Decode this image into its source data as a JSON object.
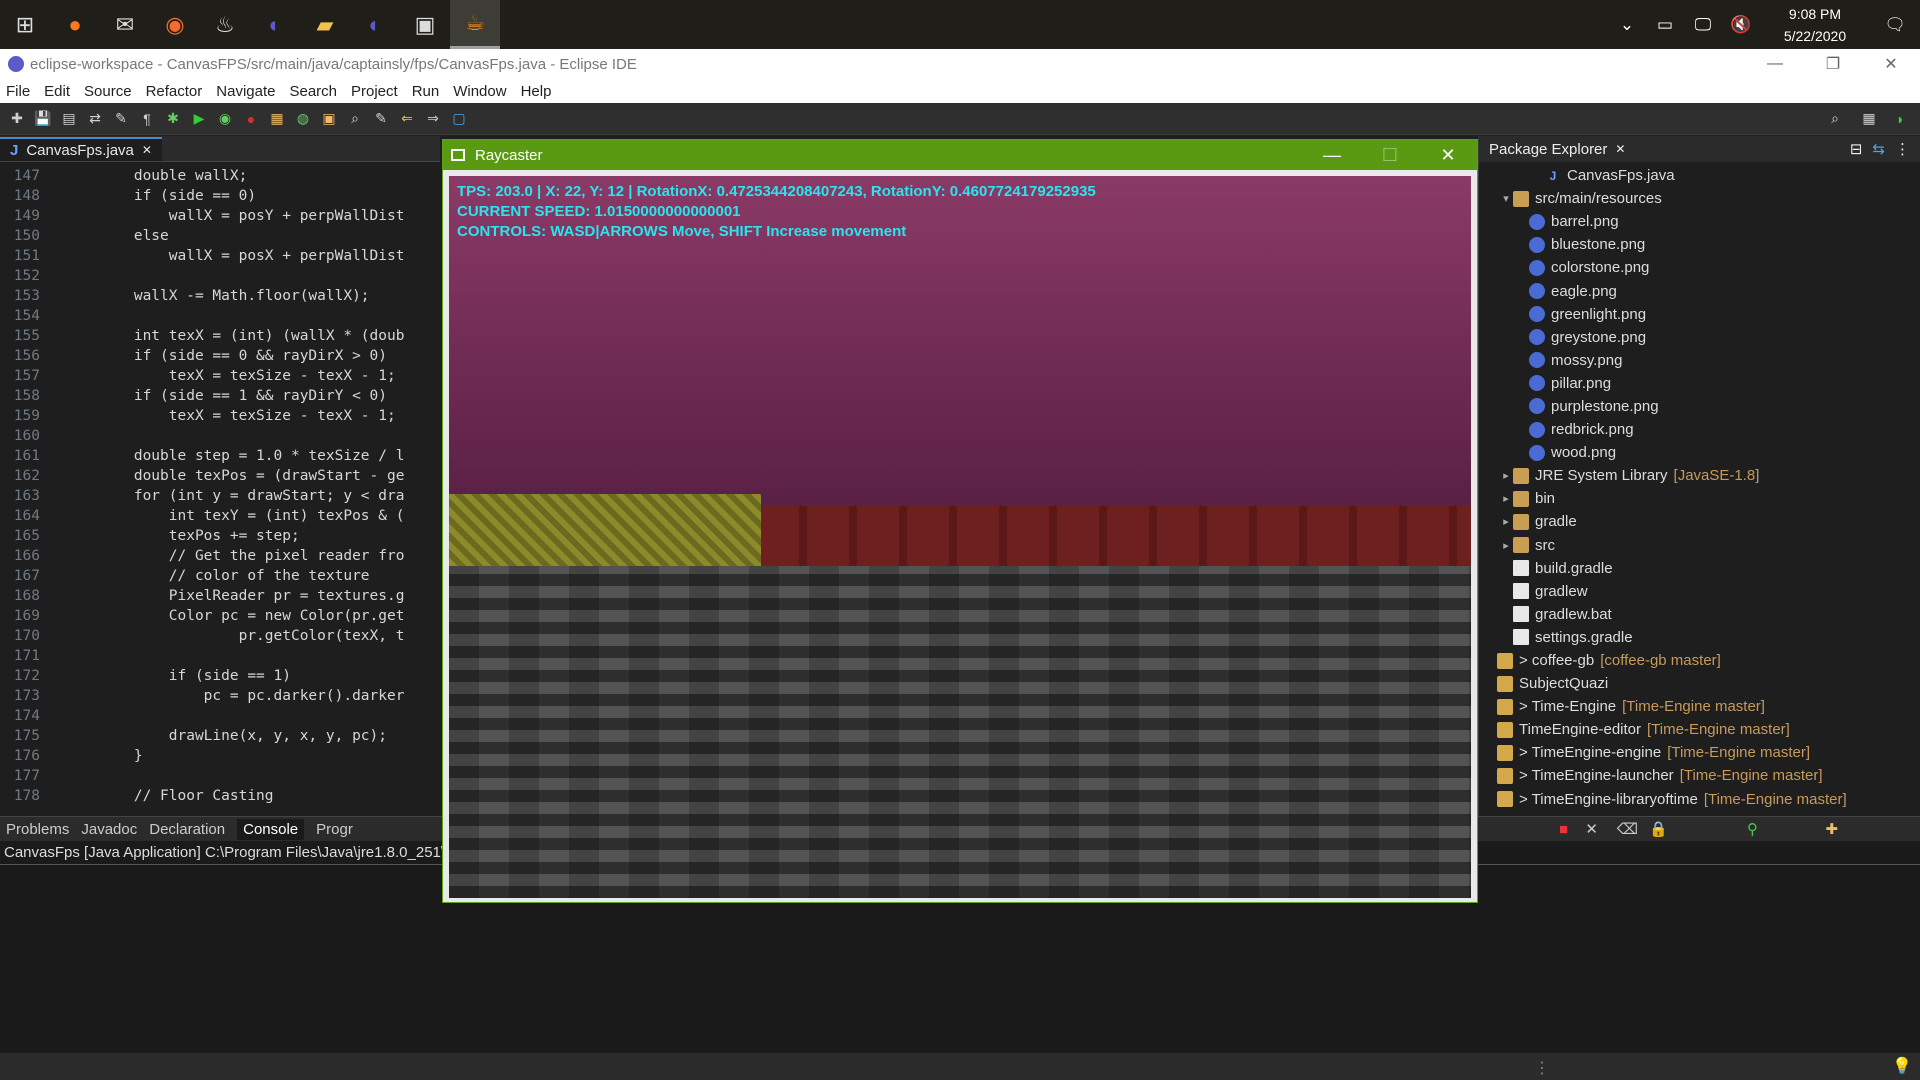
{
  "taskbar": {
    "apps": [
      "windows-start",
      "firefox",
      "mail",
      "origin",
      "steam",
      "eclipse",
      "file-explorer",
      "eclipse-2",
      "remote",
      "java"
    ],
    "time": "9:08 PM",
    "date": "5/22/2020"
  },
  "window": {
    "title": "eclipse-workspace - CanvasFPS/src/main/java/captainsly/fps/CanvasFps.java - Eclipse IDE"
  },
  "menu": [
    "File",
    "Edit",
    "Source",
    "Refactor",
    "Navigate",
    "Search",
    "Project",
    "Run",
    "Window",
    "Help"
  ],
  "editor": {
    "tab_label": "CanvasFps.java",
    "lines": [
      {
        "n": "147",
        "t": "        double wallX;"
      },
      {
        "n": "148",
        "t": "        if (side == 0)"
      },
      {
        "n": "149",
        "t": "            wallX = posY + perpWallDist"
      },
      {
        "n": "150",
        "t": "        else"
      },
      {
        "n": "151",
        "t": "            wallX = posX + perpWallDist"
      },
      {
        "n": "152",
        "t": ""
      },
      {
        "n": "153",
        "t": "        wallX -= Math.floor(wallX);"
      },
      {
        "n": "154",
        "t": ""
      },
      {
        "n": "155",
        "t": "        int texX = (int) (wallX * (doub"
      },
      {
        "n": "156",
        "t": "        if (side == 0 && rayDirX > 0)"
      },
      {
        "n": "157",
        "t": "            texX = texSize - texX - 1;"
      },
      {
        "n": "158",
        "t": "        if (side == 1 && rayDirY < 0)"
      },
      {
        "n": "159",
        "t": "            texX = texSize - texX - 1;"
      },
      {
        "n": "160",
        "t": ""
      },
      {
        "n": "161",
        "t": "        double step = 1.0 * texSize / l"
      },
      {
        "n": "162",
        "t": "        double texPos = (drawStart - ge"
      },
      {
        "n": "163",
        "t": "        for (int y = drawStart; y < dra"
      },
      {
        "n": "164",
        "t": "            int texY = (int) texPos & ("
      },
      {
        "n": "165",
        "t": "            texPos += step;"
      },
      {
        "n": "166",
        "t": "            // Get the pixel reader fro"
      },
      {
        "n": "167",
        "t": "            // color of the texture"
      },
      {
        "n": "168",
        "t": "            PixelReader pr = textures.g"
      },
      {
        "n": "169",
        "t": "            Color pc = new Color(pr.get"
      },
      {
        "n": "170",
        "t": "                    pr.getColor(texX, t"
      },
      {
        "n": "171",
        "t": ""
      },
      {
        "n": "172",
        "t": "            if (side == 1)"
      },
      {
        "n": "173",
        "t": "                pc = pc.darker().darker"
      },
      {
        "n": "174",
        "t": ""
      },
      {
        "n": "175",
        "t": "            drawLine(x, y, x, y, pc);"
      },
      {
        "n": "176",
        "t": "        }"
      },
      {
        "n": "177",
        "t": ""
      },
      {
        "n": "178",
        "t": "        // Floor Casting"
      }
    ]
  },
  "bottom_panel": {
    "tabs": [
      "Problems",
      "Javadoc",
      "Declaration",
      "Console",
      "Progr"
    ],
    "console_header": "CanvasFps [Java Application] C:\\Program Files\\Java\\jre1.8.0_251\\bi"
  },
  "package_explorer": {
    "title": "Package Explorer",
    "items": [
      {
        "indent": 3,
        "type": "java",
        "label": "CanvasFps.java",
        "tag": ""
      },
      {
        "indent": 1,
        "type": "folder",
        "label": "src/main/resources",
        "tag": "",
        "arrow": "▾"
      },
      {
        "indent": 2,
        "type": "png",
        "label": "barrel.png",
        "tag": ""
      },
      {
        "indent": 2,
        "type": "png",
        "label": "bluestone.png",
        "tag": ""
      },
      {
        "indent": 2,
        "type": "png",
        "label": "colorstone.png",
        "tag": ""
      },
      {
        "indent": 2,
        "type": "png",
        "label": "eagle.png",
        "tag": ""
      },
      {
        "indent": 2,
        "type": "png",
        "label": "greenlight.png",
        "tag": ""
      },
      {
        "indent": 2,
        "type": "png",
        "label": "greystone.png",
        "tag": ""
      },
      {
        "indent": 2,
        "type": "png",
        "label": "mossy.png",
        "tag": ""
      },
      {
        "indent": 2,
        "type": "png",
        "label": "pillar.png",
        "tag": ""
      },
      {
        "indent": 2,
        "type": "png",
        "label": "purplestone.png",
        "tag": ""
      },
      {
        "indent": 2,
        "type": "png",
        "label": "redbrick.png",
        "tag": ""
      },
      {
        "indent": 2,
        "type": "png",
        "label": "wood.png",
        "tag": ""
      },
      {
        "indent": 1,
        "type": "folder",
        "label": "JRE System Library",
        "tag": "[JavaSE-1.8]",
        "arrow": "▸"
      },
      {
        "indent": 1,
        "type": "folder",
        "label": "bin",
        "tag": "",
        "arrow": "▸"
      },
      {
        "indent": 1,
        "type": "folder",
        "label": "gradle",
        "tag": "",
        "arrow": "▸"
      },
      {
        "indent": 1,
        "type": "folder",
        "label": "src",
        "tag": "",
        "arrow": "▸"
      },
      {
        "indent": 1,
        "type": "file",
        "label": "build.gradle",
        "tag": ""
      },
      {
        "indent": 1,
        "type": "file",
        "label": "gradlew",
        "tag": ""
      },
      {
        "indent": 1,
        "type": "file",
        "label": "gradlew.bat",
        "tag": ""
      },
      {
        "indent": 1,
        "type": "file",
        "label": "settings.gradle",
        "tag": ""
      },
      {
        "indent": 0,
        "type": "proj",
        "label": "> coffee-gb",
        "tag": "[coffee-gb master]"
      },
      {
        "indent": 0,
        "type": "proj",
        "label": "SubjectQuazi",
        "tag": ""
      },
      {
        "indent": 0,
        "type": "proj",
        "label": "> Time-Engine",
        "tag": "[Time-Engine master]"
      },
      {
        "indent": 0,
        "type": "proj",
        "label": "TimeEngine-editor",
        "tag": "[Time-Engine master]"
      },
      {
        "indent": 0,
        "type": "proj",
        "label": "> TimeEngine-engine",
        "tag": "[Time-Engine master]"
      },
      {
        "indent": 0,
        "type": "proj",
        "label": "> TimeEngine-launcher",
        "tag": "[Time-Engine master]"
      },
      {
        "indent": 0,
        "type": "proj",
        "label": "> TimeEngine-libraryoftime",
        "tag": "[Time-Engine master]"
      }
    ]
  },
  "raycaster": {
    "title": "Raycaster",
    "hud": [
      "TPS: 203.0 | X: 22, Y: 12 | RotationX: 0.4725344208407243, RotationY: 0.4607724179252935",
      "CURRENT SPEED: 1.0150000000000001",
      "CONTROLS: WASD|ARROWS Move, SHIFT Increase movement"
    ],
    "accent_color": "#5a9a13",
    "hud_color": "#28e6f0"
  }
}
